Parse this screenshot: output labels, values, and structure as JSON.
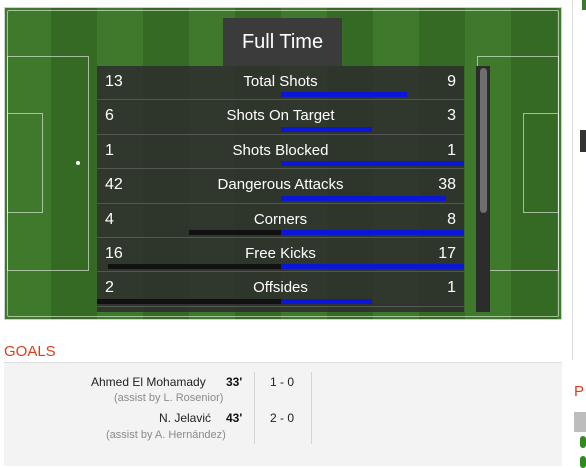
{
  "title": "Full Time",
  "colors": {
    "home_bar": "#111111",
    "away_bar": "#0b17d6",
    "goals_heading": "#e23b1a"
  },
  "stats": [
    {
      "label": "Total Shots",
      "home": "13",
      "away": "9",
      "home_pct": 0.0,
      "away_pct": 0.69
    },
    {
      "label": "Shots On Target",
      "home": "6",
      "away": "3",
      "home_pct": 0.0,
      "away_pct": 0.5
    },
    {
      "label": "Shots Blocked",
      "home": "1",
      "away": "1",
      "home_pct": 0.0,
      "away_pct": 1.0
    },
    {
      "label": "Dangerous Attacks",
      "home": "42",
      "away": "38",
      "home_pct": 0.0,
      "away_pct": 0.9
    },
    {
      "label": "Corners",
      "home": "4",
      "away": "8",
      "home_pct": 0.5,
      "away_pct": 1.0
    },
    {
      "label": "Free Kicks",
      "home": "16",
      "away": "17",
      "home_pct": 0.94,
      "away_pct": 1.0
    },
    {
      "label": "Offsides",
      "home": "2",
      "away": "1",
      "home_pct": 1.0,
      "away_pct": 0.5
    }
  ],
  "goals": {
    "heading": "GOALS",
    "items": [
      {
        "scorer": "Ahmed El Mohamady",
        "minute": "33'",
        "assist": "(assist by L. Rosenior)",
        "score": "1 - 0"
      },
      {
        "scorer": "N. Jelavić",
        "minute": "43'",
        "assist": "(assist by A. Hernández)",
        "score": "2 - 0"
      }
    ]
  },
  "sidebar": {
    "partial_heading": "P"
  }
}
